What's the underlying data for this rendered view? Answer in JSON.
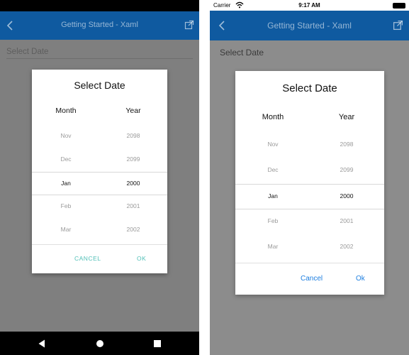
{
  "android": {
    "app_title": "Getting Started - Xaml",
    "field_placeholder": "Select Date",
    "dialog": {
      "title": "Select Date",
      "month_header": "Month",
      "year_header": "Year",
      "rows": [
        {
          "month": "Nov",
          "year": "2098"
        },
        {
          "month": "Dec",
          "year": "2099"
        },
        {
          "month": "Jan",
          "year": "2000"
        },
        {
          "month": "Feb",
          "year": "2001"
        },
        {
          "month": "Mar",
          "year": "2002"
        }
      ],
      "cancel_label": "CANCEL",
      "ok_label": "OK"
    },
    "colors": {
      "appbar": "#0f5aa0",
      "accent": "#52c0b8"
    }
  },
  "ios": {
    "carrier": "Carrier",
    "time": "9:17 AM",
    "app_title": "Getting Started - Xaml",
    "field_placeholder": "Select Date",
    "dialog": {
      "title": "Select Date",
      "month_header": "Month",
      "year_header": "Year",
      "rows": [
        {
          "month": "Nov",
          "year": "2098"
        },
        {
          "month": "Dec",
          "year": "2099"
        },
        {
          "month": "Jan",
          "year": "2000"
        },
        {
          "month": "Feb",
          "year": "2001"
        },
        {
          "month": "Mar",
          "year": "2002"
        }
      ],
      "cancel_label": "Cancel",
      "ok_label": "Ok"
    },
    "colors": {
      "navbar": "#0f5aa0",
      "accent": "#1e7fe0"
    }
  },
  "icons": {
    "back": "chevron-left-icon",
    "external": "open-external-icon",
    "wifi": "wifi-icon",
    "battery": "battery-icon",
    "nav_back": "triangle-back-icon",
    "nav_home": "circle-home-icon",
    "nav_recents": "square-recents-icon"
  }
}
